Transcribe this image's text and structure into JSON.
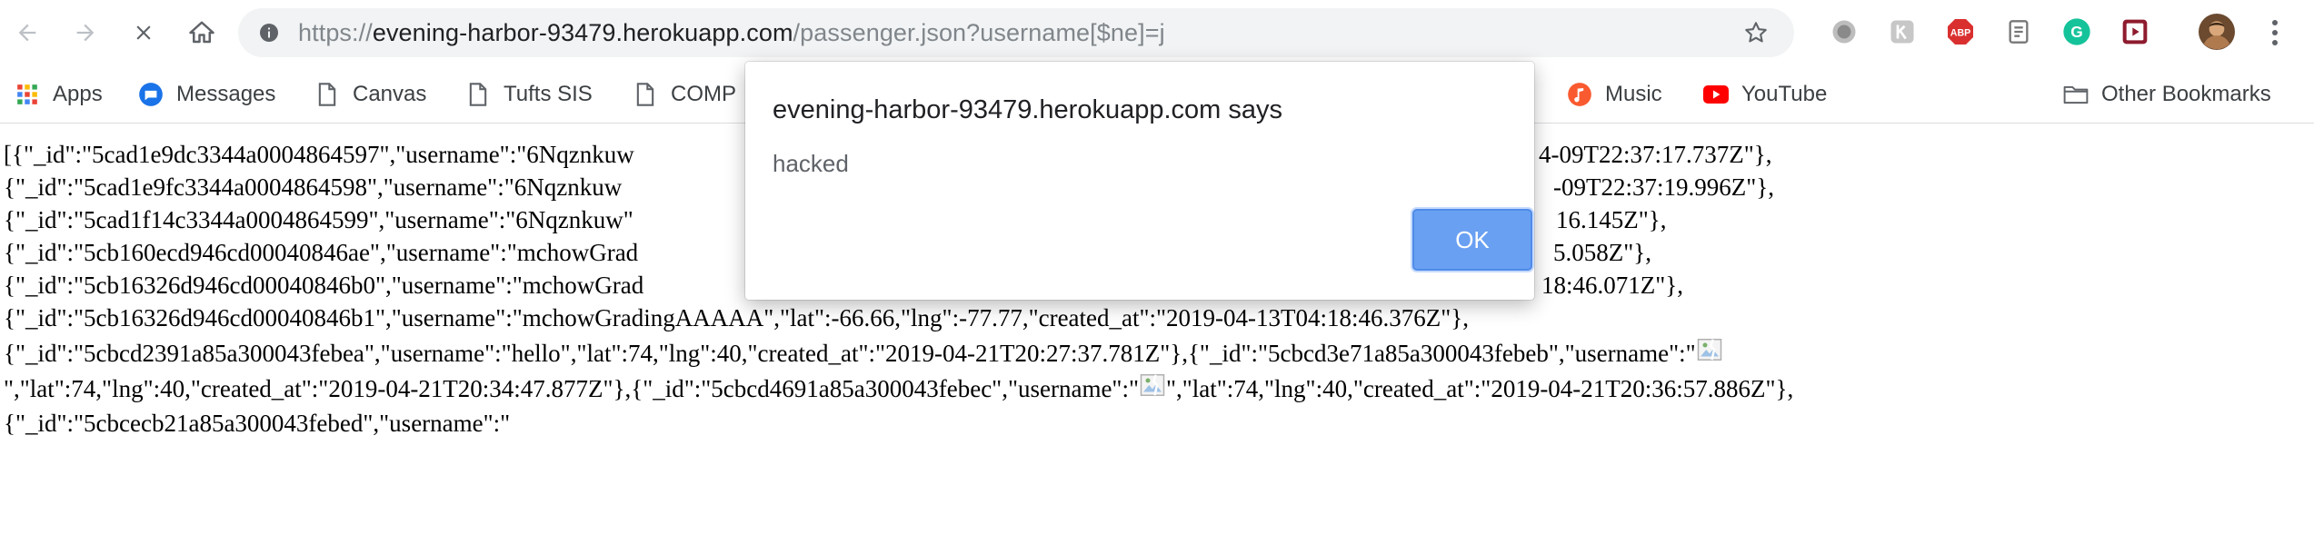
{
  "browser": {
    "url_scheme": "https://",
    "url_host": "evening-harbor-93479.herokuapp.com",
    "url_path": "/passenger.json?username[$ne]=j"
  },
  "bookmarks": [
    {
      "label": "Apps",
      "icon": "apps-grid-icon"
    },
    {
      "label": "Messages",
      "icon": "messages-icon"
    },
    {
      "label": "Canvas",
      "icon": "page-icon"
    },
    {
      "label": "Tufts SIS",
      "icon": "page-icon"
    },
    {
      "label": "COMP",
      "icon": "page-icon"
    },
    {
      "label": "Music",
      "icon": "music-icon"
    },
    {
      "label": "YouTube",
      "icon": "youtube-icon"
    },
    {
      "label": "Other Bookmarks",
      "icon": "folder-icon"
    }
  ],
  "content": {
    "lines": [
      "[{\"_id\":\"5cad1e9dc3344a0004864597\",\"username\":\"6Nqznkuw",
      "{\"_id\":\"5cad1e9fc3344a0004864598\",\"username\":\"6Nqznkuw",
      "{\"_id\":\"5cad1f14c3344a0004864599\",\"username\":\"6Nqznkuw\"",
      "{\"_id\":\"5cb160ecd946cd00040846ae\",\"username\":\"mchowGrad",
      "{\"_id\":\"5cb16326d946cd00040846b0\",\"username\":\"mchowGrad",
      "{\"_id\":\"5cb16326d946cd00040846b1\",\"username\":\"mchowGradingAAAAA\",\"lat\":-66.66,\"lng\":-77.77,\"created_at\":\"2019-04-13T04:18:46.376Z\"},",
      "{\"_id\":\"5cbcd2391a85a300043febea\",\"username\":\"hello\",\"lat\":74,\"lng\":40,\"created_at\":\"2019-04-21T20:27:37.781Z\"},{\"_id\":\"5cbcd3e71a85a300043febeb\",\"username\":\"",
      "\",\"lat\":74,\"lng\":40,\"created_at\":\"2019-04-21T20:34:47.877Z\"},{\"_id\":\"5cbcd4691a85a300043febec\",\"username\":\"",
      "{\"_id\":\"5cbcecb21a85a300043febed\",\"username\":\""
    ],
    "line8_tail": "\",\"lat\":74,\"lng\":40,\"created_at\":\"2019-04-21T20:36:57.886Z\"},",
    "right_fragments": [
      "4-09T22:37:17.737Z\"},",
      "-09T22:37:19.996Z\"},",
      "16.145Z\"},",
      "5.058Z\"},",
      "18:46.071Z\"},"
    ]
  },
  "dialog": {
    "title": "evening-harbor-93479.herokuapp.com says",
    "message": "hacked",
    "ok_label": "OK"
  },
  "colors": {
    "ok_button": "#69a0f2",
    "abp_red": "#d9302f",
    "grammarly_green": "#15c39a",
    "youtube_red": "#ff0000",
    "music_orange": "#fa5a2f",
    "messages_blue": "#1a73e8"
  }
}
